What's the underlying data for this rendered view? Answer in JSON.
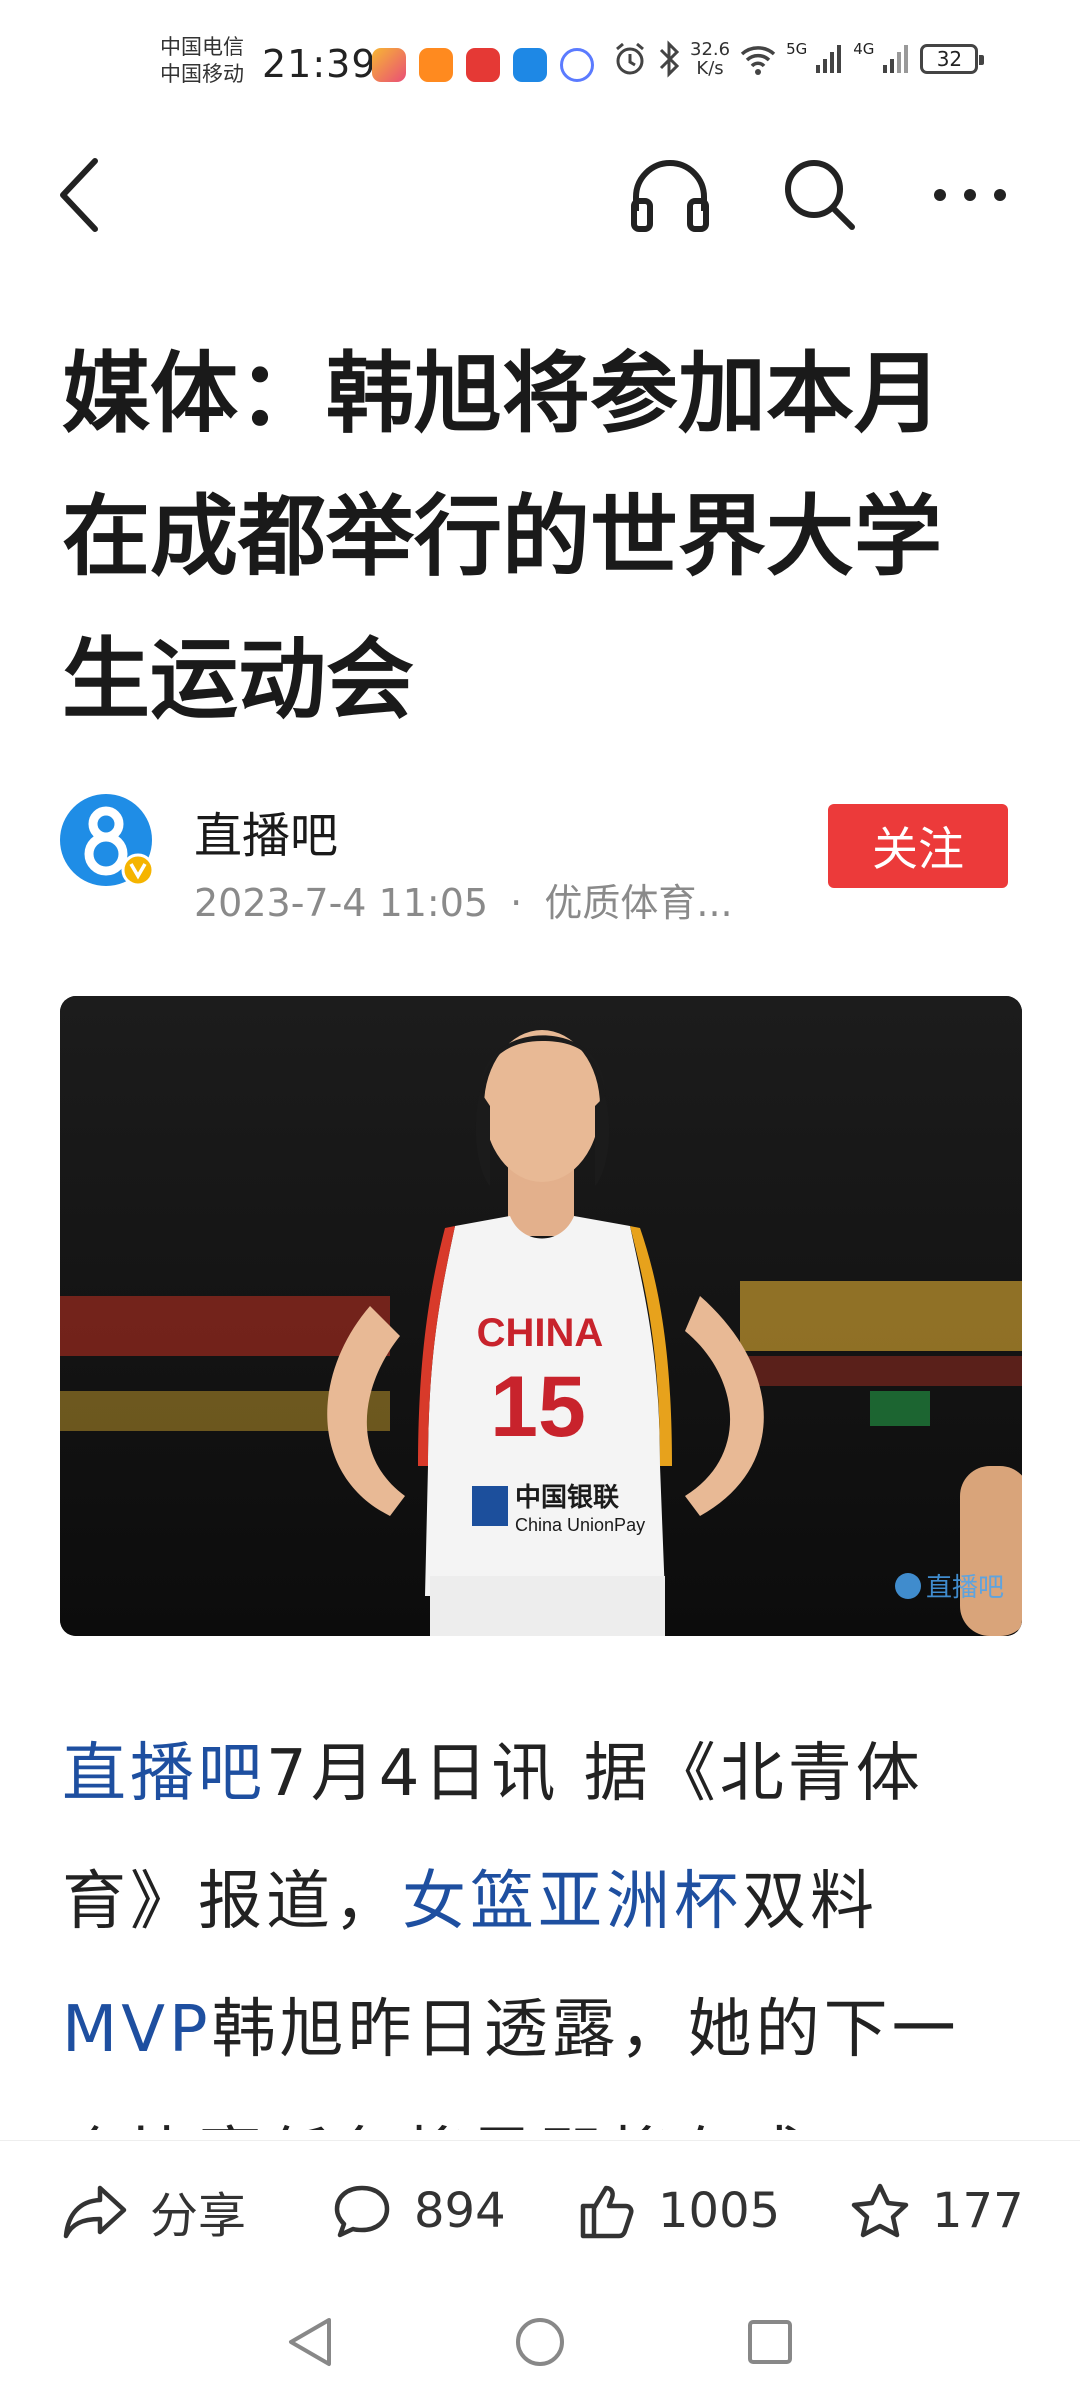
{
  "status_bar": {
    "carrier1": "中国电信",
    "carrier2": "中国移动",
    "time": "21:39",
    "net_speed_value": "32.6",
    "net_speed_unit": "K/s",
    "signal1": "5G",
    "signal2": "4G",
    "battery": "32",
    "app_icons": [
      "app-store-icon",
      "video-app-icon",
      "huawei-app-icon",
      "weather-app-icon",
      "music-app-icon"
    ]
  },
  "toolbar": {
    "back_icon": "back-arrow-icon",
    "listen_icon": "headphones-icon",
    "search_icon": "search-icon",
    "more_icon": "more-icon"
  },
  "article": {
    "title": "媒体：韩旭将参加本月在成都举行的世界大学生运动会",
    "author": "直播吧",
    "timestamp": "2023-7-4 11:05",
    "meta_sep": "·",
    "category": "优质体育...",
    "follow_label": "关注",
    "image": {
      "jersey_team": "CHINA",
      "jersey_number": "15",
      "sponsor_cn": "中国银联",
      "sponsor_en": "China UnionPay",
      "watermark": "直播吧"
    },
    "body": {
      "link1": "直播吧",
      "text1": "7月4日讯 据《北青体育》报道，",
      "link2": "女篮亚洲杯",
      "text2": "双料",
      "link3": "MVP",
      "text3": "韩旭昨日透露，她的下一个比赛任务将是即将在成"
    }
  },
  "action_bar": {
    "share_label": "分享",
    "comments": "894",
    "likes": "1005",
    "favorites": "177"
  },
  "colors": {
    "accent_red": "#ec3a3a",
    "link_blue": "#1e4fa0"
  }
}
